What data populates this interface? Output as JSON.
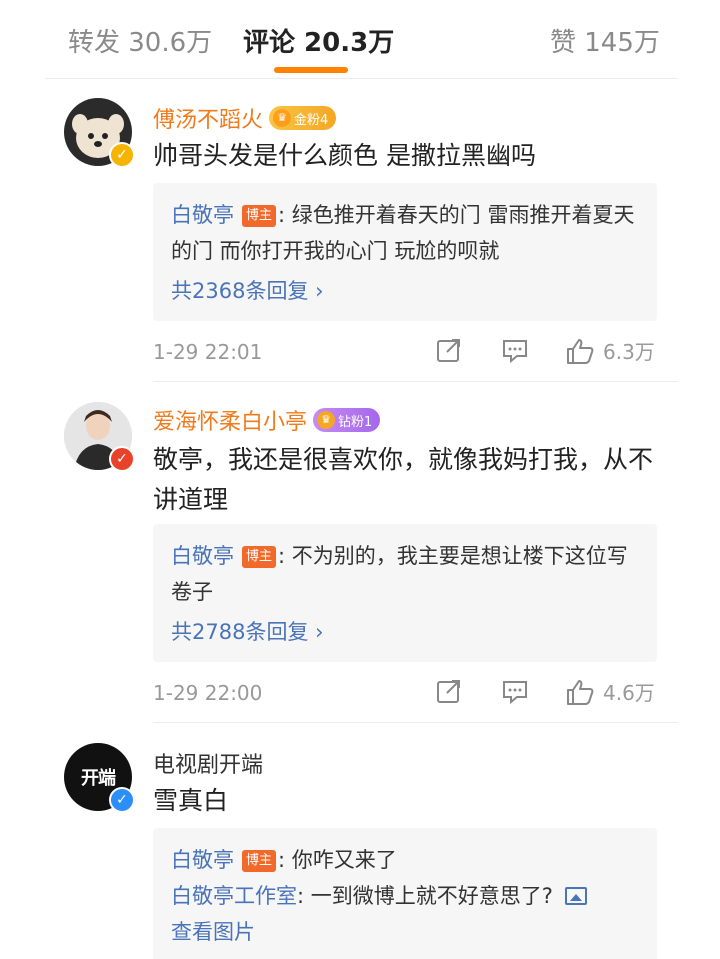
{
  "tabs": {
    "repost": "转发 30.6万",
    "comments": "评论 20.3万",
    "likes": "赞 145万"
  },
  "comments": [
    {
      "username": "傅汤不蹈火",
      "fan_badge": "金粉4",
      "text": "帅哥头发是什么颜色 是撒拉黑幽吗",
      "reply": {
        "author": "白敬亭",
        "tag": "博主",
        "text": ": 绿色推开着春天的门 雷雨推开着夏天的门 而你打开我的心门 玩尬的呗就",
        "more": "共2368条回复 ›"
      },
      "time": "1-29 22:01",
      "likes": "6.3万"
    },
    {
      "username": "爱海怀柔白小亭",
      "fan_badge": "钻粉1",
      "text": "敬亭，我还是很喜欢你，就像我妈打我，从不讲道理",
      "reply": {
        "author": "白敬亭",
        "tag": "博主",
        "text": ": 不为别的，我主要是想让楼下这位写卷子",
        "more": "共2788条回复 ›"
      },
      "time": "1-29 22:00",
      "likes": "4.6万"
    },
    {
      "username": "电视剧开端",
      "avatar_text": "开端",
      "text": "雪真白",
      "reply": {
        "author": "白敬亭",
        "tag": "博主",
        "text": ": 你咋又来了",
        "author2": "白敬亭工作室",
        "text2": ": 一到微博上就不好意思了?",
        "more": "查看图片"
      }
    }
  ],
  "colors": {
    "accent": "#ff8200",
    "username": "#f07b1d",
    "link": "#4a73b8",
    "blogger_tag": "#f16a2c"
  },
  "icons": [
    "share-icon",
    "comment-icon",
    "like-icon",
    "image-icon",
    "verified-icon",
    "crown-icon"
  ]
}
